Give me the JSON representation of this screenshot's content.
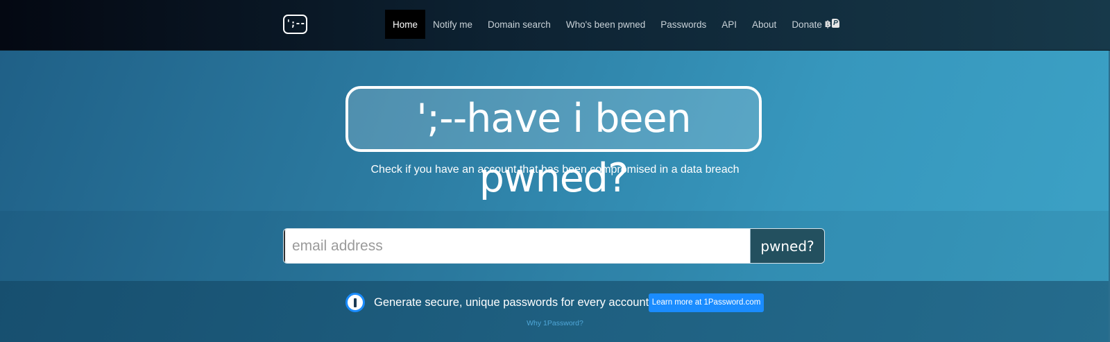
{
  "navbar": {
    "logo_text": "';--",
    "items": [
      {
        "label": "Home",
        "active": true
      },
      {
        "label": "Notify me"
      },
      {
        "label": "Domain search"
      },
      {
        "label": "Who's been pwned"
      },
      {
        "label": "Passwords"
      },
      {
        "label": "API"
      },
      {
        "label": "About"
      },
      {
        "label": "Donate"
      }
    ],
    "donate_icons": [
      "bitcoin-icon",
      "paypal-icon"
    ]
  },
  "hero": {
    "title": "';--have i been pwned?",
    "subtitle": "Check if you have an account that has been compromised in a data breach"
  },
  "search": {
    "placeholder": "email address",
    "value": "",
    "button_label": "pwned?"
  },
  "promo": {
    "icon": "1password-icon",
    "text": "Generate secure, unique passwords for every account",
    "button_label": "Learn more at 1Password.com",
    "link_label": "Why 1Password?"
  },
  "colors": {
    "accent_blue": "#1a8cff",
    "button_dark": "#23505f",
    "nav_active_bg": "#000000"
  }
}
